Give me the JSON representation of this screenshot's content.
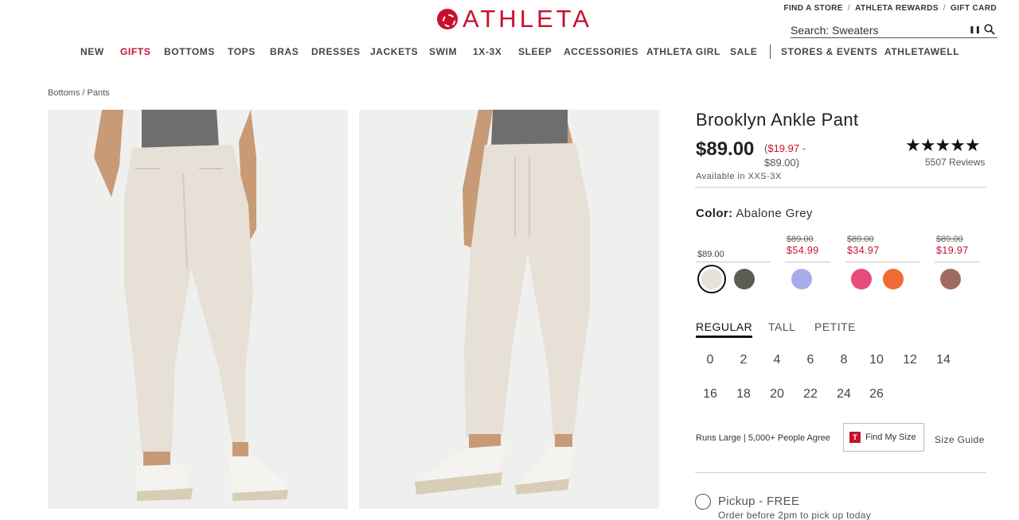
{
  "header": {
    "logo_text": "ATHLETA",
    "util_links": [
      "FIND A STORE",
      "ATHLETA REWARDS",
      "GIFT CARD"
    ],
    "search_value": "Search: Sweaters"
  },
  "nav": [
    "NEW",
    "GIFTS",
    "BOTTOMS",
    "TOPS",
    "BRAS",
    "DRESSES",
    "JACKETS",
    "SWIM",
    "1X-3X",
    "SLEEP",
    "ACCESSORIES",
    "ATHLETA GIRL",
    "SALE",
    "STORES & EVENTS",
    "ATHLETAWELL"
  ],
  "breadcrumb": "Bottoms / Pants",
  "product": {
    "title": "Brooklyn Ankle Pant",
    "price": "$89.00",
    "range_open": "(",
    "range_low": "$19.97",
    "range_dash": " -",
    "range_high": "$89.00)",
    "availability": "Available in XXS-3X",
    "stars": "★★★★★",
    "rating": 4.5,
    "reviews": "5507 Reviews",
    "color_label": "Color:",
    "color_name": "Abalone Grey",
    "price_groups": [
      {
        "base": "$89.00"
      },
      {
        "strike": "$89.00",
        "sale": "$54.99"
      },
      {
        "strike": "$89.00",
        "sale": "$34.97"
      },
      {
        "strike": "$89.00",
        "sale": "$19.97"
      }
    ],
    "swatch_colors": [
      "#e7e2d9",
      "#5b5d50",
      "#a9abeb",
      "#e64b7b",
      "#f06a33",
      "#a06b5e"
    ],
    "fits": [
      "REGULAR",
      "TALL",
      "PETITE"
    ],
    "sizes_row1": [
      "0",
      "2",
      "4",
      "6",
      "8",
      "10",
      "12",
      "14"
    ],
    "sizes_row2": [
      "16",
      "18",
      "20",
      "22",
      "24",
      "26"
    ],
    "runs_large": "Runs Large | 5,000+ People Agree",
    "find_my_size_logo": "T",
    "find_my_size": "Find My Size",
    "size_guide": "Size Guide",
    "pickup": "Pickup - FREE",
    "pickup_sub": "Order before 2pm to pick up today"
  },
  "colors": {
    "brand": "#c8102e",
    "pant": "#e6e0d6",
    "top": "#707070"
  }
}
